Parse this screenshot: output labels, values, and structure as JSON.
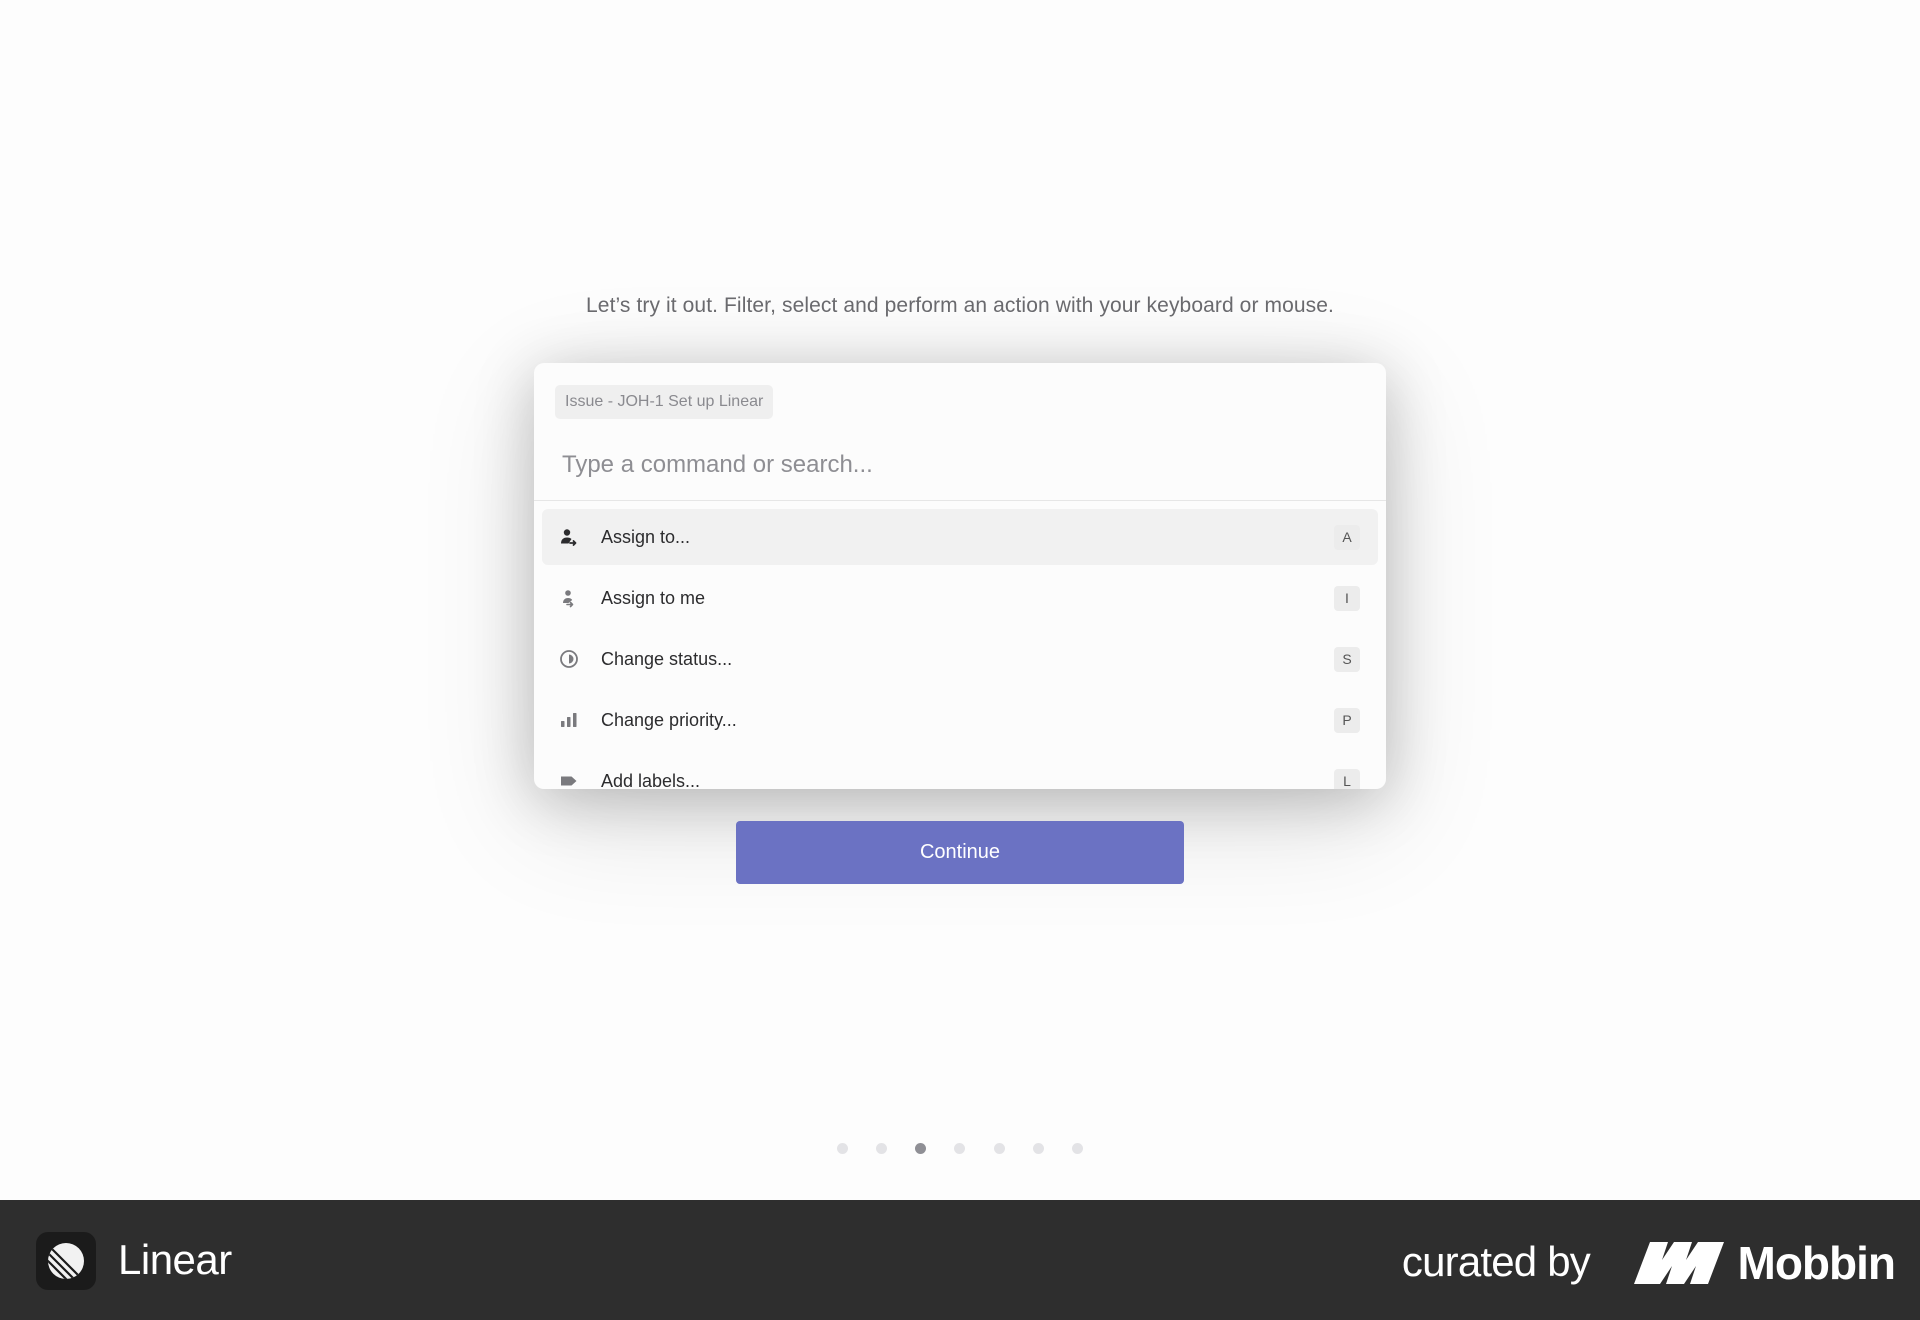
{
  "intro_text": "Let’s try it out. Filter, select and perform an action with your keyboard or mouse.",
  "palette": {
    "context": "Issue - JOH-1 Set up Linear",
    "search_placeholder": "Type a command or search...",
    "commands": [
      {
        "label": "Assign to...",
        "shortcut": "A",
        "icon": "assign-user-icon",
        "active": true
      },
      {
        "label": "Assign to me",
        "shortcut": "I",
        "icon": "assign-me-icon",
        "active": false
      },
      {
        "label": "Change status...",
        "shortcut": "S",
        "icon": "status-circle-icon",
        "active": false
      },
      {
        "label": "Change priority...",
        "shortcut": "P",
        "icon": "priority-bars-icon",
        "active": false
      },
      {
        "label": "Add labels...",
        "shortcut": "L",
        "icon": "label-tag-icon",
        "active": false
      }
    ]
  },
  "continue_label": "Continue",
  "pagination": {
    "total": 7,
    "current": 3
  },
  "footer": {
    "app_name": "Linear",
    "curated_by": "curated by",
    "brand": "Mobbin"
  },
  "colors": {
    "accent": "#6b72c3",
    "footer_bg": "#2e2e2e",
    "active_row": "#f1f1f1"
  }
}
